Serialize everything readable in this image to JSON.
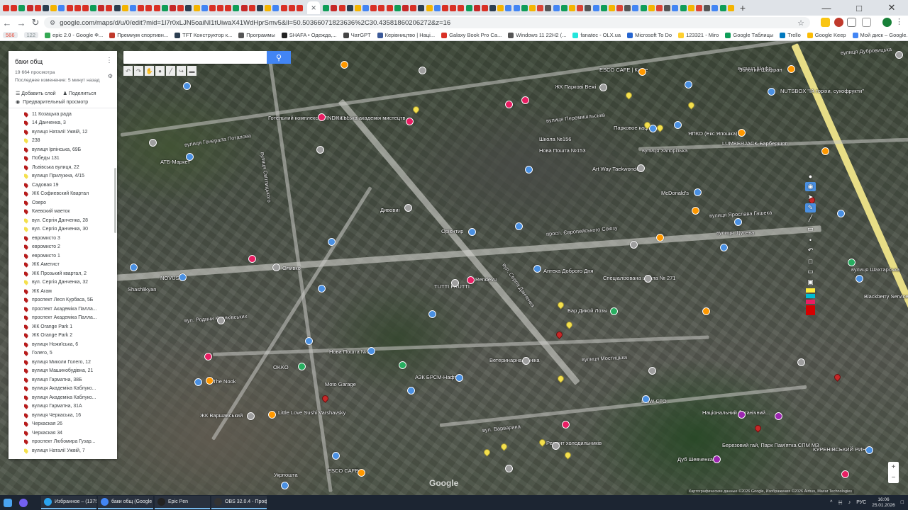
{
  "browser": {
    "url": "google.com/maps/d/u/0/edit?mid=1l7r0xLJN5oaiNI1tUiwaX41WdHprSmv5&ll=50.50366071823636%2C30.43581860206272&z=16",
    "bookmarks": [
      {
        "label": "566",
        "color": "#e74c3c",
        "count": true
      },
      {
        "label": "122",
        "color": "#7f8c8d",
        "count": true
      },
      {
        "label": "epic 2.0 - Google Ф...",
        "color": "#34a853"
      },
      {
        "label": "Премиум спортивн...",
        "color": "#c0392b"
      },
      {
        "label": "TFT Конструктор к...",
        "color": "#2c3e50"
      },
      {
        "label": "Программы",
        "color": "#555555"
      },
      {
        "label": "SHAFA • Одежда,...",
        "color": "#222222"
      },
      {
        "label": "ЧатGPT",
        "color": "#444444"
      },
      {
        "label": "Керівництво | Наці...",
        "color": "#3b5998"
      },
      {
        "label": "Galaxy Book Pro Ca...",
        "color": "#d93025"
      },
      {
        "label": "Windows 11 22H2 (...",
        "color": "#555555"
      },
      {
        "label": "fanatec - OLX.ua",
        "color": "#23e5db"
      },
      {
        "label": "Microsoft To Do",
        "color": "#2564cf"
      },
      {
        "label": "123321 - Miro",
        "color": "#ffd02f"
      },
      {
        "label": "Google Таблицы",
        "color": "#0f9d58"
      },
      {
        "label": "Trello",
        "color": "#0079bf"
      },
      {
        "label": "Google Keep",
        "color": "#fbbc04"
      },
      {
        "label": "Мой диск – Google...",
        "color": "#4285f4"
      },
      {
        "label": "Входящие (11) - ра...",
        "color": "#d93025"
      }
    ]
  },
  "panel": {
    "title": "баки общ",
    "views": "19 664 просмотра",
    "last_change": "Последнее изменение: 5 минут назад",
    "add_layer": "Добавить слой",
    "share": "Поделиться",
    "preview": "Предварительный просмотр",
    "items": [
      {
        "label": "11 Козацька рада",
        "color": "#b71c1c"
      },
      {
        "label": "14 Данченка, 3",
        "color": "#b71c1c"
      },
      {
        "label": "вулиця Наталії Ужвій, 12",
        "color": "#b71c1c"
      },
      {
        "label": "238",
        "color": "#f4e04d"
      },
      {
        "label": "вулиця Ірпінська, 69Б",
        "color": "#b71c1c"
      },
      {
        "label": "Победы 131",
        "color": "#b71c1c"
      },
      {
        "label": "Львівська вулиця, 22",
        "color": "#b71c1c"
      },
      {
        "label": "вулиця Прилужна, 4/15",
        "color": "#f4e04d"
      },
      {
        "label": "Садовая 19",
        "color": "#b71c1c"
      },
      {
        "label": "ЖК Софиевский Квартал",
        "color": "#b71c1c"
      },
      {
        "label": "Озеро",
        "color": "#b71c1c"
      },
      {
        "label": "Киевский маеток",
        "color": "#b71c1c"
      },
      {
        "label": "вул. Сергія Данченка, 28",
        "color": "#f4e04d"
      },
      {
        "label": "вул. Сергія Данченка, 30",
        "color": "#f4e04d"
      },
      {
        "label": "евромисто 3",
        "color": "#b71c1c"
      },
      {
        "label": "евромисто 2",
        "color": "#b71c1c"
      },
      {
        "label": "евромисто 1",
        "color": "#b71c1c"
      },
      {
        "label": "ЖК Аметист",
        "color": "#b71c1c"
      },
      {
        "label": "ЖК Прозький квартал, 2",
        "color": "#b71c1c"
      },
      {
        "label": "вул. Сергія Данченка, 32",
        "color": "#f4e04d"
      },
      {
        "label": "ЖК Агам",
        "color": "#b71c1c"
      },
      {
        "label": "проспект Леся Курбаса, 5Б",
        "color": "#b71c1c"
      },
      {
        "label": "проспект Академіка Палла...",
        "color": "#b71c1c"
      },
      {
        "label": "проспект Академіка Палла...",
        "color": "#b71c1c"
      },
      {
        "label": "ЖК Orange Park 1",
        "color": "#b71c1c"
      },
      {
        "label": "ЖК Orange Park 2",
        "color": "#b71c1c"
      },
      {
        "label": "вулиця Ножиїська, 6",
        "color": "#b71c1c"
      },
      {
        "label": "Голего, 5",
        "color": "#b71c1c"
      },
      {
        "label": "вулиця Миколи Голего, 12",
        "color": "#b71c1c"
      },
      {
        "label": "вулиця Машинобудівна, 21",
        "color": "#b71c1c"
      },
      {
        "label": "вулиця Гарматна, 38Б",
        "color": "#b71c1c"
      },
      {
        "label": "вулиця Академіка Каблуко...",
        "color": "#b71c1c"
      },
      {
        "label": "вулиця Академіка Каблуко...",
        "color": "#b71c1c"
      },
      {
        "label": "вулиця Гарматна, 31А",
        "color": "#b71c1c"
      },
      {
        "label": "вулиця Черкаська, 16",
        "color": "#b71c1c"
      },
      {
        "label": "Черкаская 26",
        "color": "#b71c1c"
      },
      {
        "label": "Черкаская 34",
        "color": "#b71c1c"
      },
      {
        "label": "проспект Любомира Гузар...",
        "color": "#b71c1c"
      },
      {
        "label": "вулиця Наталії Ужвій, 7",
        "color": "#f4e04d"
      }
    ]
  },
  "map": {
    "streets": [
      {
        "text": "вулиця Дубровицька"
      },
      {
        "text": "вулиця Шафр..."
      },
      {
        "text": "вулиця Перемишльська"
      },
      {
        "text": "просп. Європейського Союзу"
      },
      {
        "text": "вулиця Ярослава Гашека"
      },
      {
        "text": "вулиця Мостицька"
      },
      {
        "text": "вулиця Світлицького"
      },
      {
        "text": "вулиця Генерала Потапова"
      },
      {
        "text": "вул. Сергія Данченка"
      },
      {
        "text": "вулиця Запорізька"
      },
      {
        "text": "вул. Варварина"
      },
      {
        "text": "вул. Родини Кістяківських"
      },
      {
        "text": "вулиця Щусева"
      },
      {
        "text": "вулиця Шахтарська"
      }
    ],
    "pois": [
      {
        "text": "ESCO CAFE | Кафе"
      },
      {
        "text": "ЖК Паркові Вежі"
      },
      {
        "text": "Золотий Шафран"
      },
      {
        "text": "NUTSBOX \"ІА горіхи, сухофрукти\""
      },
      {
        "text": "Парковое кафе"
      },
      {
        "text": "ЯПКО (Екс Япошка)"
      },
      {
        "text": "LUMBERJACK Барбершоп"
      },
      {
        "text": "Школа №156"
      },
      {
        "text": "Нова Пошта №153"
      },
      {
        "text": "Art Way Taekwondo"
      },
      {
        "text": "Готельний комплекс \"WINDHILL\""
      },
      {
        "text": "Київська академія мистецтв"
      },
      {
        "text": "АТБ-Маркет"
      },
      {
        "text": "McDonald's"
      },
      {
        "text": "Орієнтир"
      },
      {
        "text": "Дивовиі"
      },
      {
        "text": "TUTTI FRUTTI"
      },
      {
        "text": "Rendevu"
      },
      {
        "text": "Аптека Доброго Дня"
      },
      {
        "text": "Спеціалізована школа № 271"
      },
      {
        "text": "NOVUS"
      },
      {
        "text": "Shashlikyan"
      },
      {
        "text": "Оливко"
      },
      {
        "text": "Нова Пошта №21"
      },
      {
        "text": "Бар Дикой Лозы"
      },
      {
        "text": "Ветеринарна клініка"
      },
      {
        "text": "The Nook"
      },
      {
        "text": "OKKO"
      },
      {
        "text": "АЗК БРСМ-Нафта"
      },
      {
        "text": "Moto Garage"
      },
      {
        "text": "ЖК Варшавський"
      },
      {
        "text": "Little Love Sushi Varshavsky"
      },
      {
        "text": "ESCO CAFE"
      },
      {
        "text": "Укрпошта"
      },
      {
        "text": "Ремонт холодильників"
      },
      {
        "text": "BMW СТО"
      },
      {
        "text": "Національний ботанічний..."
      },
      {
        "text": "Березовий гай, Парк Пам'ятка СПМ МЗ"
      },
      {
        "text": "Дуб Шевченка"
      },
      {
        "text": "КУРЕНІВСЬКИЙ РИНОК"
      },
      {
        "text": "Blackberry Service and Care"
      }
    ],
    "copyright": "Картографические данные ©2026 Google, Изображения ©2026 Airbus, Maxar Technologies",
    "google_logo": "Google"
  },
  "taskbar": {
    "tasks": [
      {
        "label": "Избранное – (1375...",
        "color": "#2aa3ef"
      },
      {
        "label": "баки общ (Google ...",
        "color": "#4285f4"
      },
      {
        "label": "Epic Pen",
        "color": "#222222"
      },
      {
        "label": "OBS 32.0.4 - Проф...",
        "color": "#333333"
      }
    ],
    "lang": "РУС",
    "time": "16:06",
    "date": "25.01.2026"
  }
}
